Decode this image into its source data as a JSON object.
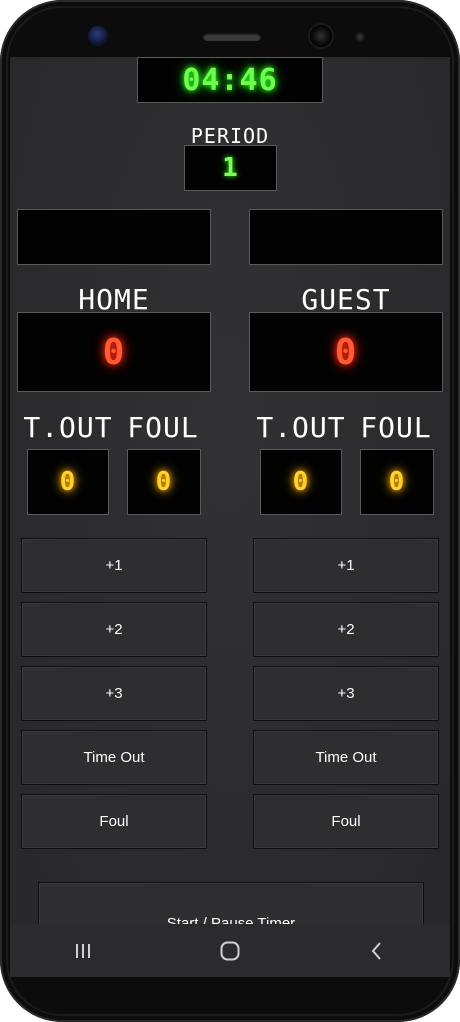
{
  "scoreboard": {
    "timer": "04:46",
    "period_label": "PERIOD",
    "period_value": "1"
  },
  "home": {
    "name": "",
    "label": "HOME",
    "score": "0",
    "timeout_label": "T.OUT",
    "foul_label": "FOUL",
    "timeouts": "0",
    "fouls": "0",
    "buttons": {
      "plus1": "+1",
      "plus2": "+2",
      "plus3": "+3",
      "timeout": "Time Out",
      "foul": "Foul"
    }
  },
  "guest": {
    "name": "",
    "label": "GUEST",
    "score": "0",
    "timeout_label": "T.OUT",
    "foul_label": "FOUL",
    "timeouts": "0",
    "fouls": "0",
    "buttons": {
      "plus1": "+1",
      "plus2": "+2",
      "plus3": "+3",
      "timeout": "Time Out",
      "foul": "Foul"
    }
  },
  "controls": {
    "start_pause": "Start / Pause Timer"
  },
  "navbar": {
    "icons": [
      "recent-apps-icon",
      "home-icon",
      "back-icon"
    ]
  },
  "colors": {
    "timer_green": "#6dff4d",
    "score_red": "#ff5a32",
    "stat_yellow": "#ffd22a",
    "panel_bg": "#2e2e30"
  }
}
